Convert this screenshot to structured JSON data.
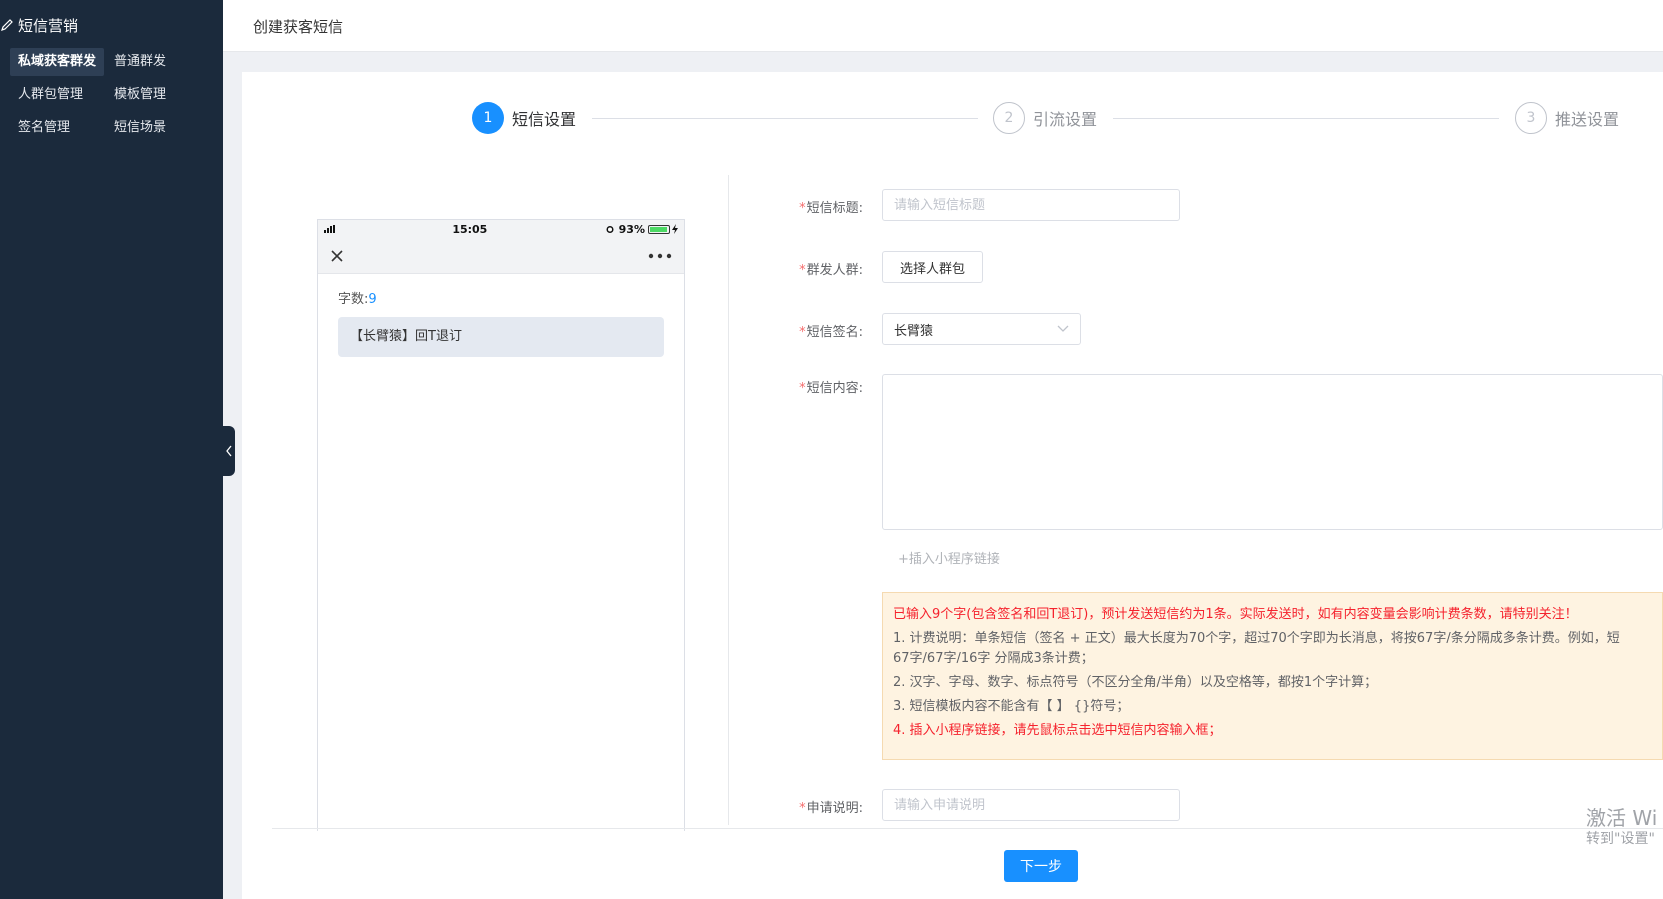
{
  "sidebar": {
    "title": "短信营销",
    "items": [
      "私域获客群发",
      "普通群发",
      "人群包管理",
      "模板管理",
      "签名管理",
      "短信场景"
    ]
  },
  "header": {
    "title": "创建获客短信"
  },
  "steps": [
    {
      "num": "1",
      "label": "短信设置"
    },
    {
      "num": "2",
      "label": "引流设置"
    },
    {
      "num": "3",
      "label": "推送设置"
    }
  ],
  "phone": {
    "time": "15:05",
    "battery": "93%",
    "battery_level": 0.93,
    "count_label": "字数:",
    "count_value": "9",
    "message": "【长臂猿】回T退订"
  },
  "form": {
    "title_label": "短信标题:",
    "title_placeholder": "请输入短信标题",
    "group_label": "群发人群:",
    "group_button": "选择人群包",
    "signature_label": "短信签名:",
    "signature_value": "长臂猿",
    "content_label": "短信内容:",
    "insert_link": "+插入小程序链接",
    "desc_label": "申请说明:",
    "desc_placeholder": "请输入申请说明"
  },
  "notice": {
    "summary": "已输入9个字(包含签名和回T退订)，预计发送短信约为1条。实际发送时，如有内容变量会影响计费条数，请特别关注！",
    "line1a": "1. 计费说明：单条短信（签名 + 正文）最大长度为70个字，超过70个字即为长消息，将按67字/条分隔成多条计费。例如，短",
    "line1b": "67字/67字/16字 分隔成3条计费；",
    "line2": "2. 汉字、字母、数字、标点符号（不区分全角/半角）以及空格等，都按1个字计算；",
    "line3": "3. 短信模板内容不能含有【 】 {}符号；",
    "line4": "4. 插入小程序链接，请先鼠标点击选中短信内容输入框；"
  },
  "next_button": "下一步",
  "watermark": {
    "line1": "激活 Wi",
    "line2": "转到\"设置\""
  },
  "colors": {
    "sidebar": "#1b2a3c",
    "primary": "#1890ff",
    "danger": "#f5222d",
    "notice_bg": "#fef3e1"
  }
}
